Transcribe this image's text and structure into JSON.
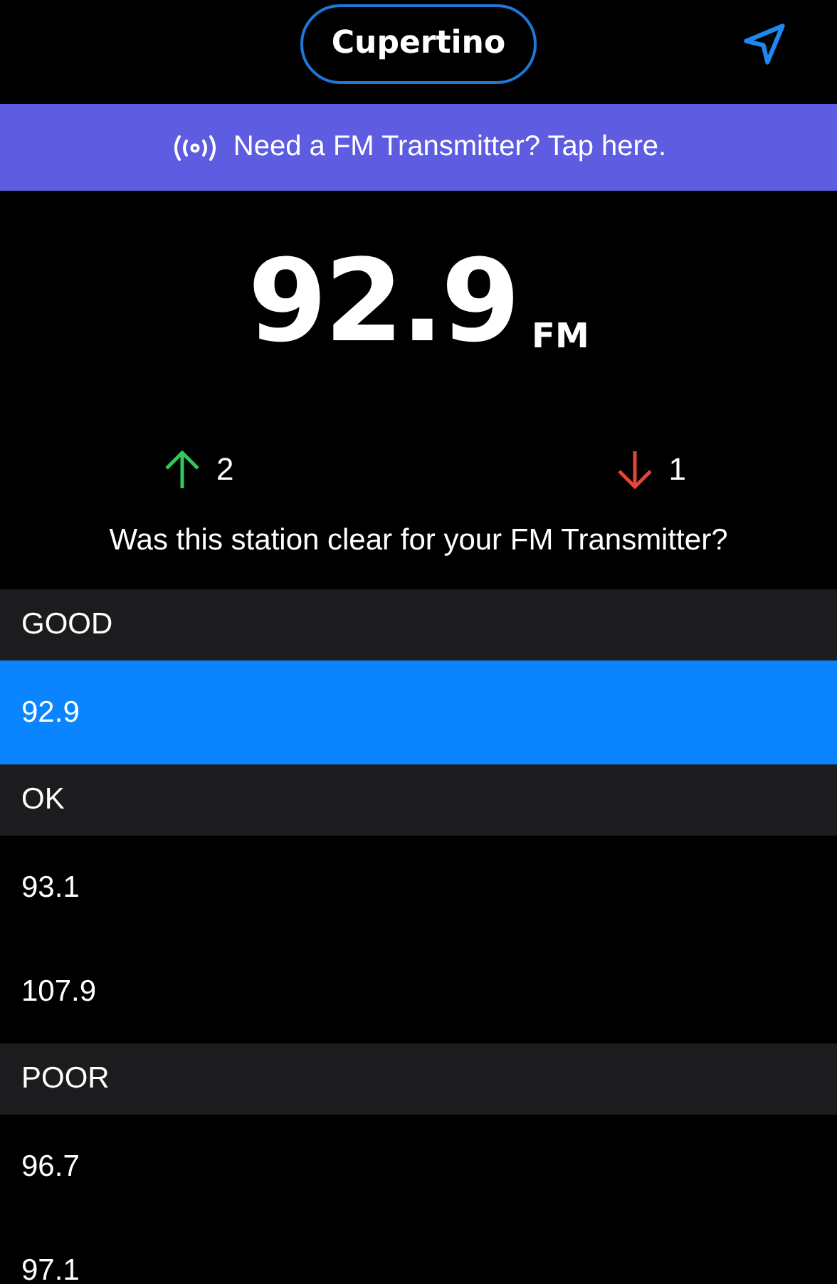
{
  "location": {
    "label": "Cupertino"
  },
  "banner": {
    "text": "Need a FM Transmitter? Tap here."
  },
  "station": {
    "frequency": "92.9",
    "band": "FM"
  },
  "votes": {
    "up": "2",
    "down": "1"
  },
  "question": "Was this station clear for your FM Transmitter?",
  "sections": [
    {
      "label": "GOOD",
      "stations": [
        {
          "frequency": "92.9",
          "selected": true
        }
      ]
    },
    {
      "label": "OK",
      "stations": [
        {
          "frequency": "93.1",
          "selected": false
        },
        {
          "frequency": "107.9",
          "selected": false
        }
      ]
    },
    {
      "label": "POOR",
      "stations": [
        {
          "frequency": "96.7",
          "selected": false
        },
        {
          "frequency": "97.1",
          "selected": false
        }
      ]
    }
  ]
}
